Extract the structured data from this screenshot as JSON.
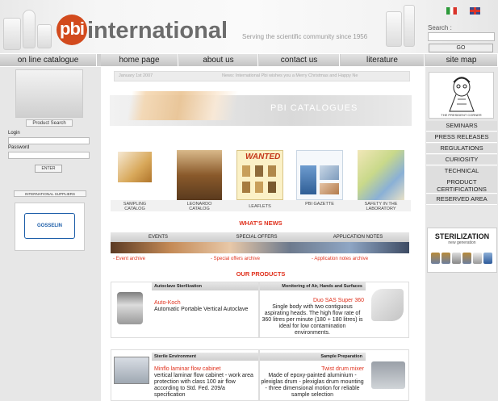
{
  "brand": {
    "logo_short": "pbi",
    "logo_rest": "international",
    "tagline": "Serving the scientific community since 1956"
  },
  "search": {
    "label": "Search :",
    "go": "GO"
  },
  "nav": {
    "catalogue": "on line catalogue",
    "items": [
      "home page",
      "about us",
      "contact us",
      "literature"
    ],
    "site_map": "site map"
  },
  "left": {
    "product_search": "Product Search",
    "login": "Login",
    "password": "Password",
    "enter": "ENTER",
    "intl_suppliers": "INTERNATIONAL SUPPLIERS",
    "supplier_logo": "GOSSELIN"
  },
  "news_ticker": {
    "date": "January 1st 2007",
    "text": "News: International Pbi wishes you a Merry Christmas and Happy Ne"
  },
  "catalogues": {
    "title": "PBI CATALOGUES",
    "items": [
      "SAMPLING CATALOG",
      "LEONARDO CATALOG",
      "LEAFLETS",
      "PBI GAZETTE",
      "SAFETY IN THE LABORATORY"
    ],
    "wanted": "WANTED"
  },
  "whats_news": {
    "title": "WHAT'S NEWS",
    "tabs": [
      "EVENTS",
      "SPECIAL OFFERS",
      "APPLICATION NOTES"
    ],
    "archives": [
      "- Event archive",
      "- Special offers archive",
      "- Application notes archive"
    ]
  },
  "products": {
    "title": "OUR PRODUCTS",
    "items": [
      {
        "category": "Autoclave Sterilization",
        "name": "Auto-Koch",
        "desc": "Automatic Portable Vertical Autoclave"
      },
      {
        "category": "Monitoring of Air, Hands and Surfaces",
        "name": "Duo SAS Super 360",
        "desc": "Single body with two contiguous aspirating heads. The high flow rate of 360 litres per minute (180 + 180 litres) is ideal for low contamination environments."
      },
      {
        "category": "Sterile Environment",
        "name": "Minflo laminar flow cabinet",
        "desc": "vertical laminar flow cabinet - work area protection with class 100 air flow according to Std. Fed. 209/a specification"
      },
      {
        "category": "Sample Preparation",
        "name": "Twist drum mixer",
        "desc": "Made of epoxy-painted aluminium - plexiglas drum - plexiglas drum mounting - three dimensional motion for reliable sample selection"
      }
    ]
  },
  "right": {
    "president_label": "THE PRESIDENT CORNER",
    "menu": [
      "SEMINARS",
      "PRESS RELEASES",
      "REGULATIONS",
      "CURIOSITY",
      "TECHNICAL ASSISTANCE",
      "PRODUCT CERTIFICATIONS",
      "RESERVED AREA"
    ],
    "sterilization_title": "STERILIZATION",
    "sterilization_sub": "new generation"
  },
  "colors": {
    "accent": "#e0311d",
    "logo": "#d24a1d",
    "panel": "#e7e7e7"
  }
}
